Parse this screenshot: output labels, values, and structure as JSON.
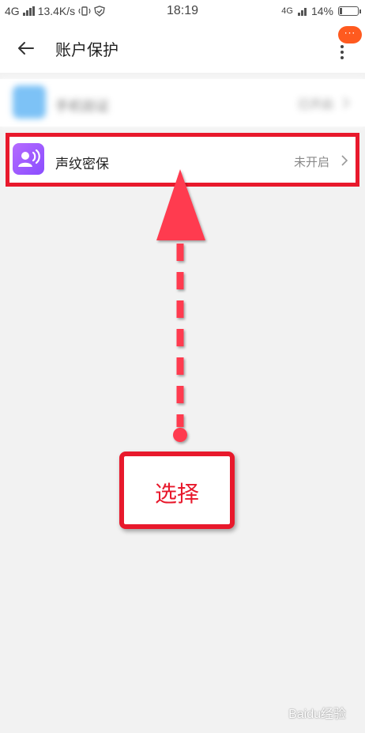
{
  "status_bar": {
    "network": "4G",
    "speed": "13.4K/s",
    "time": "18:19",
    "network_right": "4G",
    "battery": "14%",
    "battery_level": 0.14
  },
  "header": {
    "title": "账户保护",
    "badge": "···"
  },
  "rows": [
    {
      "label": "手机验证",
      "status": "已开启"
    },
    {
      "label": "声纹密保",
      "status": "未开启"
    }
  ],
  "annotation": {
    "text": "选择"
  },
  "colors": {
    "highlight": "#e8192c",
    "voice_icon": "#9b5cff",
    "badge": "#ff5a1f"
  },
  "watermark": "Baidu经验"
}
